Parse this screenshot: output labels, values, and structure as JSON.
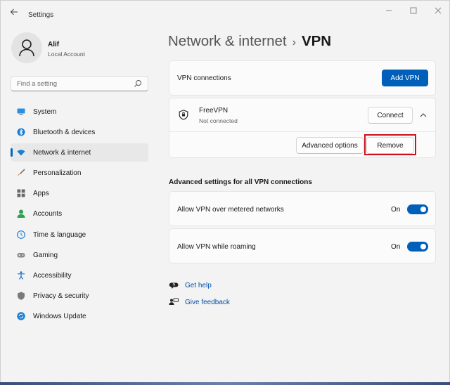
{
  "window": {
    "app_title": "Settings"
  },
  "profile": {
    "name": "Alif",
    "account_type": "Local Account"
  },
  "search": {
    "placeholder": "Find a setting"
  },
  "nav": {
    "items": [
      {
        "label": "System",
        "icon": "monitor-icon",
        "active": false
      },
      {
        "label": "Bluetooth & devices",
        "icon": "bluetooth-icon",
        "active": false
      },
      {
        "label": "Network & internet",
        "icon": "wifi-icon",
        "active": true
      },
      {
        "label": "Personalization",
        "icon": "brush-icon",
        "active": false
      },
      {
        "label": "Apps",
        "icon": "apps-icon",
        "active": false
      },
      {
        "label": "Accounts",
        "icon": "person-icon",
        "active": false
      },
      {
        "label": "Time & language",
        "icon": "globe-clock-icon",
        "active": false
      },
      {
        "label": "Gaming",
        "icon": "gamepad-icon",
        "active": false
      },
      {
        "label": "Accessibility",
        "icon": "accessibility-icon",
        "active": false
      },
      {
        "label": "Privacy & security",
        "icon": "shield-icon",
        "active": false
      },
      {
        "label": "Windows Update",
        "icon": "update-icon",
        "active": false
      }
    ]
  },
  "header": {
    "parent": "Network & internet",
    "separator": "›",
    "current": "VPN"
  },
  "vpn_connections": {
    "label": "VPN connections",
    "add_button": "Add VPN"
  },
  "vpn_entry": {
    "name": "FreeVPN",
    "status": "Not connected",
    "connect_button": "Connect",
    "advanced_button": "Advanced options",
    "remove_button": "Remove"
  },
  "advanced": {
    "heading": "Advanced settings for all VPN connections",
    "metered": {
      "label": "Allow VPN over metered networks",
      "state_text": "On",
      "on": true
    },
    "roaming": {
      "label": "Allow VPN while roaming",
      "state_text": "On",
      "on": true
    }
  },
  "help_links": {
    "get_help": "Get help",
    "give_feedback": "Give feedback"
  },
  "colors": {
    "accent": "#005fb8",
    "highlight": "#d0101c"
  }
}
